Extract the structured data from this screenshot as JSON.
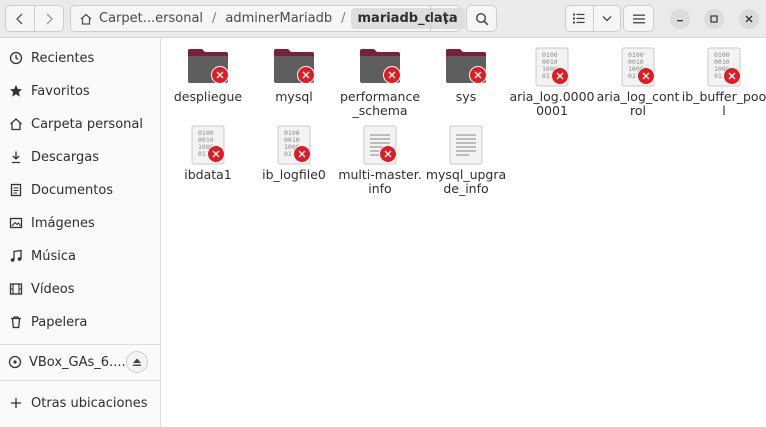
{
  "window": {
    "breadcrumb": [
      "Carpet...ersonal",
      "adminerMariadb",
      "mariadb_data"
    ],
    "breadcrumb_separator": "/"
  },
  "sidebar": {
    "items": [
      {
        "label": "Recientes",
        "icon": "clock-icon"
      },
      {
        "label": "Favoritos",
        "icon": "star-icon"
      },
      {
        "label": "Carpeta personal",
        "icon": "home-icon"
      },
      {
        "label": "Descargas",
        "icon": "download-icon"
      },
      {
        "label": "Documentos",
        "icon": "document-icon"
      },
      {
        "label": "Imágenes",
        "icon": "image-icon"
      },
      {
        "label": "Música",
        "icon": "music-icon"
      },
      {
        "label": "Vídeos",
        "icon": "video-icon"
      },
      {
        "label": "Papelera",
        "icon": "trash-icon"
      }
    ],
    "device": {
      "label": "VBox_GAs_6....",
      "icon": "disc-icon"
    },
    "other": {
      "label": "Otras ubicaciones",
      "icon": "plus-icon"
    }
  },
  "files": [
    {
      "label": "despliegue",
      "type": "folder",
      "locked": true
    },
    {
      "label": "mysql",
      "type": "folder",
      "locked": true
    },
    {
      "label": "performance_schema",
      "type": "folder",
      "locked": true
    },
    {
      "label": "sys",
      "type": "folder",
      "locked": true
    },
    {
      "label": "aria_log.00000001",
      "type": "binary",
      "locked": true
    },
    {
      "label": "aria_log_control",
      "type": "binary",
      "locked": true
    },
    {
      "label": "ib_buffer_pool",
      "type": "binary",
      "locked": true
    },
    {
      "label": "ibdata1",
      "type": "binary",
      "locked": true
    },
    {
      "label": "ib_logfile0",
      "type": "binary",
      "locked": true
    },
    {
      "label": "multi-master.info",
      "type": "text",
      "locked": true
    },
    {
      "label": "mysql_upgrade_info",
      "type": "text",
      "locked": false
    }
  ],
  "colors": {
    "folder": "#7a1f3d",
    "folder_front": "#5e5e5e",
    "lock_badge": "#e01b24"
  }
}
